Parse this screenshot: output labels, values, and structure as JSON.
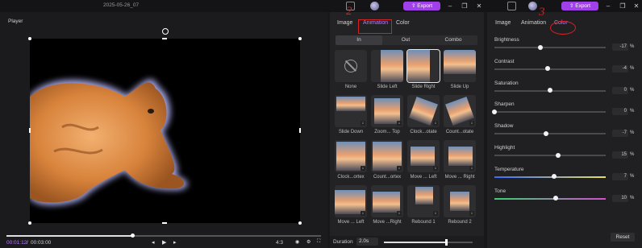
{
  "window": {
    "project_title": "2025-05-26_07",
    "export_label": "Export"
  },
  "player": {
    "title": "Player",
    "current_time": "00:01:12",
    "separator": "/",
    "total_time": "00:03:00",
    "progress": 0.4,
    "aspect_ratio": "4:3"
  },
  "animation_panel": {
    "tabs": [
      {
        "label": "Image"
      },
      {
        "label": "Animation"
      },
      {
        "label": "Color"
      }
    ],
    "active_tab": "Animation",
    "annotation_number": "2",
    "modes": [
      {
        "label": "In"
      },
      {
        "label": "Out"
      },
      {
        "label": "Combo"
      }
    ],
    "active_mode": "In",
    "items": [
      {
        "label": "None",
        "icon": "none-icon"
      },
      {
        "label": "Slide Left",
        "icon": "thumbnail"
      },
      {
        "label": "Slide Right",
        "icon": "thumbnail",
        "selected": true
      },
      {
        "label": "Slide Up",
        "icon": "thumbnail"
      },
      {
        "label": "Slide Down",
        "icon": "thumbnail"
      },
      {
        "label": "Zoom... Top",
        "icon": "thumbnail"
      },
      {
        "label": "Clock...otate",
        "icon": "thumbnail"
      },
      {
        "label": "Count...otate",
        "icon": "thumbnail"
      },
      {
        "label": "Clock...ortex",
        "icon": "thumbnail"
      },
      {
        "label": "Count...ortex",
        "icon": "thumbnail"
      },
      {
        "label": "Move ... Left",
        "icon": "thumbnail"
      },
      {
        "label": "Move ... Right",
        "icon": "thumbnail"
      },
      {
        "label": "Move ... Left",
        "icon": "thumbnail"
      },
      {
        "label": "Move ...Right",
        "icon": "thumbnail"
      },
      {
        "label": "Rebound 1",
        "icon": "thumbnail"
      },
      {
        "label": "Rebound 2",
        "icon": "thumbnail"
      }
    ],
    "duration_label": "Duration",
    "duration_value": "2.0s",
    "duration_fraction": 0.7
  },
  "color_panel": {
    "tabs": [
      {
        "label": "Image"
      },
      {
        "label": "Animation"
      },
      {
        "label": "Color"
      }
    ],
    "active_tab": "Color",
    "annotation_number": "3",
    "adjustments": [
      {
        "label": "Brightness",
        "value": "-17",
        "unit": "%",
        "level": 0.415
      },
      {
        "label": "Contrast",
        "value": "-4",
        "unit": "%",
        "level": 0.48
      },
      {
        "label": "Saturation",
        "value": "0",
        "unit": "%",
        "level": 0.5
      },
      {
        "label": "Sharpen",
        "value": "0",
        "unit": "%",
        "level": 0.0
      },
      {
        "label": "Shadow",
        "value": "-7",
        "unit": "%",
        "level": 0.465
      },
      {
        "label": "Highlight",
        "value": "15",
        "unit": "%",
        "level": 0.575
      },
      {
        "label": "Temperature",
        "value": "7",
        "unit": "%",
        "level": 0.535
      },
      {
        "label": "Tone",
        "value": "10",
        "unit": "%",
        "level": 0.55
      }
    ],
    "reset_label": "Reset"
  },
  "colors": {
    "accent": "#b57cff",
    "export": "#a040e8",
    "annotation": "#d42020"
  }
}
